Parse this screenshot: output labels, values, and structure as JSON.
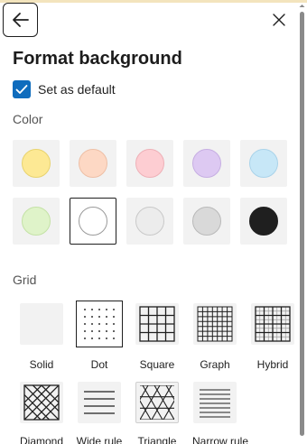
{
  "panel": {
    "title": "Format background",
    "back_icon": "arrow-left-icon",
    "close_icon": "close-icon"
  },
  "default_option": {
    "label": "Set as default",
    "checked": true,
    "accent": "#0f6cbd"
  },
  "color_section": {
    "label": "Color",
    "swatches": [
      {
        "name": "yellow",
        "color": "#fde994",
        "border": "#e8d36e",
        "selected": false
      },
      {
        "name": "peach",
        "color": "#fdd8c4",
        "border": "#eebfa6",
        "selected": false
      },
      {
        "name": "pink",
        "color": "#fdcdd2",
        "border": "#eeb0b7",
        "selected": false
      },
      {
        "name": "lavender",
        "color": "#ddc9f2",
        "border": "#c6aee2",
        "selected": false
      },
      {
        "name": "light-blue",
        "color": "#c7e7f7",
        "border": "#a9d3ea",
        "selected": false
      },
      {
        "name": "light-green",
        "color": "#dff3c9",
        "border": "#c4e2a6",
        "selected": false
      },
      {
        "name": "white",
        "color": "#ffffff",
        "border": "#9a9a9a",
        "selected": true
      },
      {
        "name": "light-gray",
        "color": "#ececec",
        "border": "#c9c9c9",
        "selected": false
      },
      {
        "name": "gray",
        "color": "#d9d9d9",
        "border": "#b9b9b9",
        "selected": false
      },
      {
        "name": "black",
        "color": "#1f1f1f",
        "border": "#1f1f1f",
        "selected": false
      }
    ]
  },
  "grid_section": {
    "label": "Grid",
    "options": [
      {
        "label": "Solid",
        "icon": "solid-pattern-icon",
        "selected": false
      },
      {
        "label": "Dot",
        "icon": "dot-pattern-icon",
        "selected": true
      },
      {
        "label": "Square",
        "icon": "square-grid-icon",
        "selected": false
      },
      {
        "label": "Graph",
        "icon": "graph-grid-icon",
        "selected": false
      },
      {
        "label": "Hybrid",
        "icon": "hybrid-grid-icon",
        "selected": false
      },
      {
        "label": "Diamond",
        "icon": "diamond-pattern-icon",
        "selected": false
      },
      {
        "label": "Wide rule",
        "icon": "wide-rule-icon",
        "selected": false
      },
      {
        "label": "Triangle",
        "icon": "triangle-pattern-icon",
        "selected": false
      },
      {
        "label": "Narrow rule",
        "icon": "narrow-rule-icon",
        "selected": false
      }
    ]
  }
}
